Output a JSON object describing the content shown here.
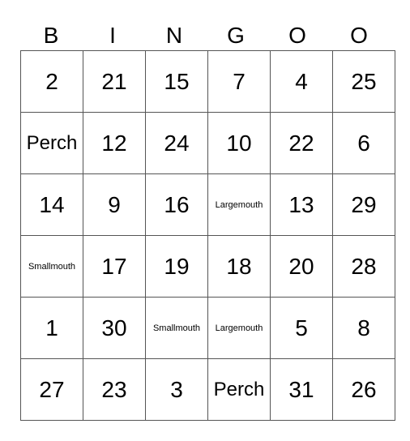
{
  "header": [
    "B",
    "I",
    "N",
    "G",
    "O",
    "O"
  ],
  "rows": [
    [
      "2",
      "21",
      "15",
      "7",
      "4",
      "25"
    ],
    [
      "Perch",
      "12",
      "24",
      "10",
      "22",
      "6"
    ],
    [
      "14",
      "9",
      "16",
      "Largemouth",
      "13",
      "29"
    ],
    [
      "Smallmouth",
      "17",
      "19",
      "18",
      "20",
      "28"
    ],
    [
      "1",
      "30",
      "Smallmouth",
      "Largemouth",
      "5",
      "8"
    ],
    [
      "27",
      "23",
      "3",
      "Perch",
      "31",
      "26"
    ]
  ]
}
